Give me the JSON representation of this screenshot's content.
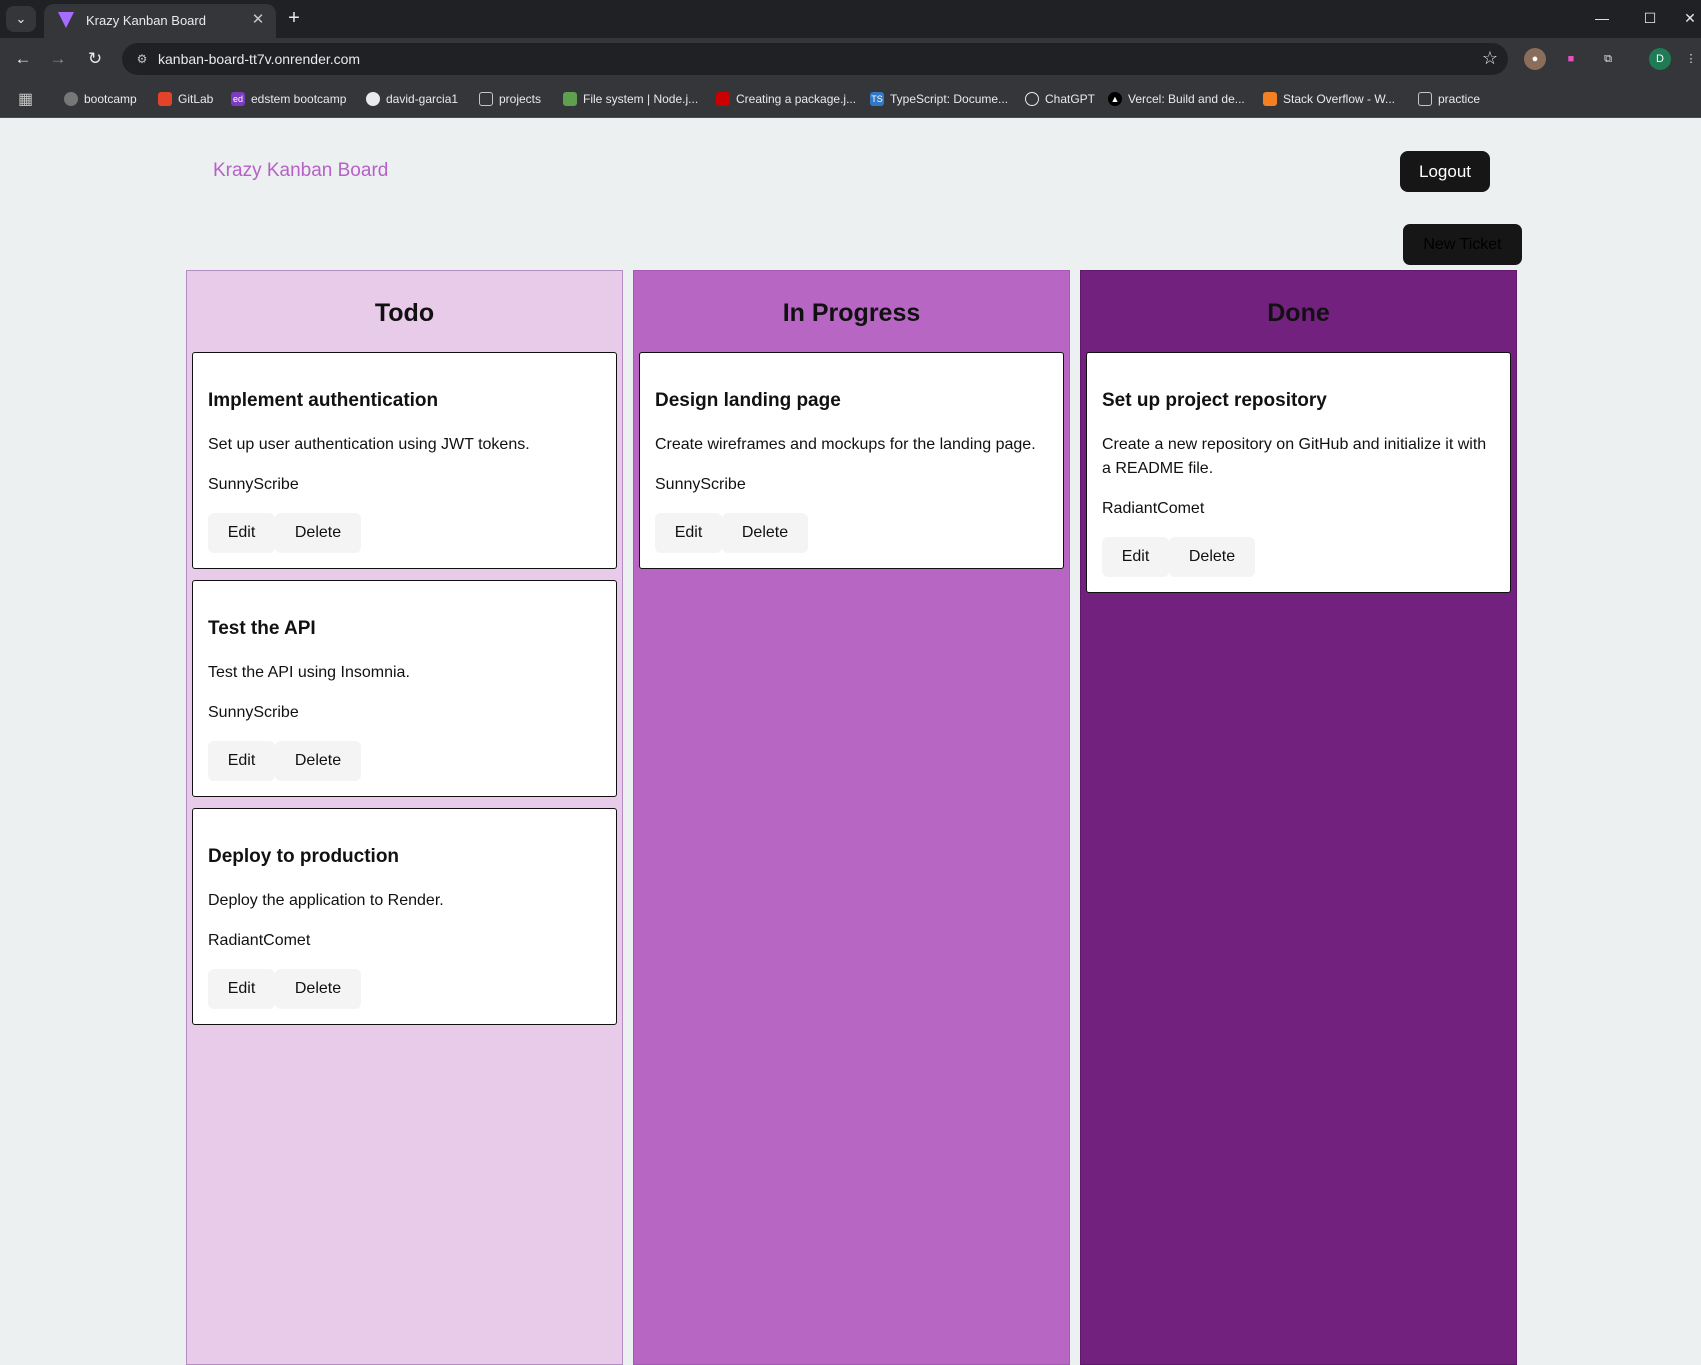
{
  "browser": {
    "tab_title": "Krazy Kanban Board",
    "url": "kanban-board-tt7v.onrender.com",
    "profile_initial": "D",
    "bookmarks": [
      {
        "label": "bootcamp",
        "icon": "globe-icon"
      },
      {
        "label": "GitLab",
        "icon": "gitlab-icon"
      },
      {
        "label": "edstem bootcamp",
        "icon": "edstem-icon"
      },
      {
        "label": "david-garcia1",
        "icon": "github-icon"
      },
      {
        "label": "projects",
        "icon": "folder-icon"
      },
      {
        "label": "File system | Node.j...",
        "icon": "nodejs-icon"
      },
      {
        "label": "Creating a package.j...",
        "icon": "npm-icon"
      },
      {
        "label": "TypeScript: Docume...",
        "icon": "typescript-icon"
      },
      {
        "label": "ChatGPT",
        "icon": "chatgpt-icon"
      },
      {
        "label": "Vercel: Build and de...",
        "icon": "vercel-icon"
      },
      {
        "label": "Stack Overflow - W...",
        "icon": "stackoverflow-icon"
      },
      {
        "label": "practice",
        "icon": "folder-icon"
      }
    ]
  },
  "header": {
    "title": "Krazy Kanban Board",
    "logout_label": "Logout",
    "new_ticket_label": "New Ticket"
  },
  "columns": [
    {
      "title": "Todo",
      "color": "#e7cbe9",
      "cards": [
        {
          "title": "Implement authentication",
          "description": "Set up user authentication using JWT tokens.",
          "assignee": "SunnyScribe",
          "edit": "Edit",
          "delete": "Delete"
        },
        {
          "title": "Test the API",
          "description": "Test the API using Insomnia.",
          "assignee": "SunnyScribe",
          "edit": "Edit",
          "delete": "Delete"
        },
        {
          "title": "Deploy to production",
          "description": "Deploy the application to Render.",
          "assignee": "RadiantComet",
          "edit": "Edit",
          "delete": "Delete"
        }
      ]
    },
    {
      "title": "In Progress",
      "color": "#b766c4",
      "cards": [
        {
          "title": "Design landing page",
          "description": "Create wireframes and mockups for the landing page.",
          "assignee": "SunnyScribe",
          "edit": "Edit",
          "delete": "Delete"
        }
      ]
    },
    {
      "title": "Done",
      "color": "#73217f",
      "cards": [
        {
          "title": "Set up project repository",
          "description": "Create a new repository on GitHub and initialize it with a README file.",
          "assignee": "RadiantComet",
          "edit": "Edit",
          "delete": "Delete"
        }
      ]
    }
  ]
}
